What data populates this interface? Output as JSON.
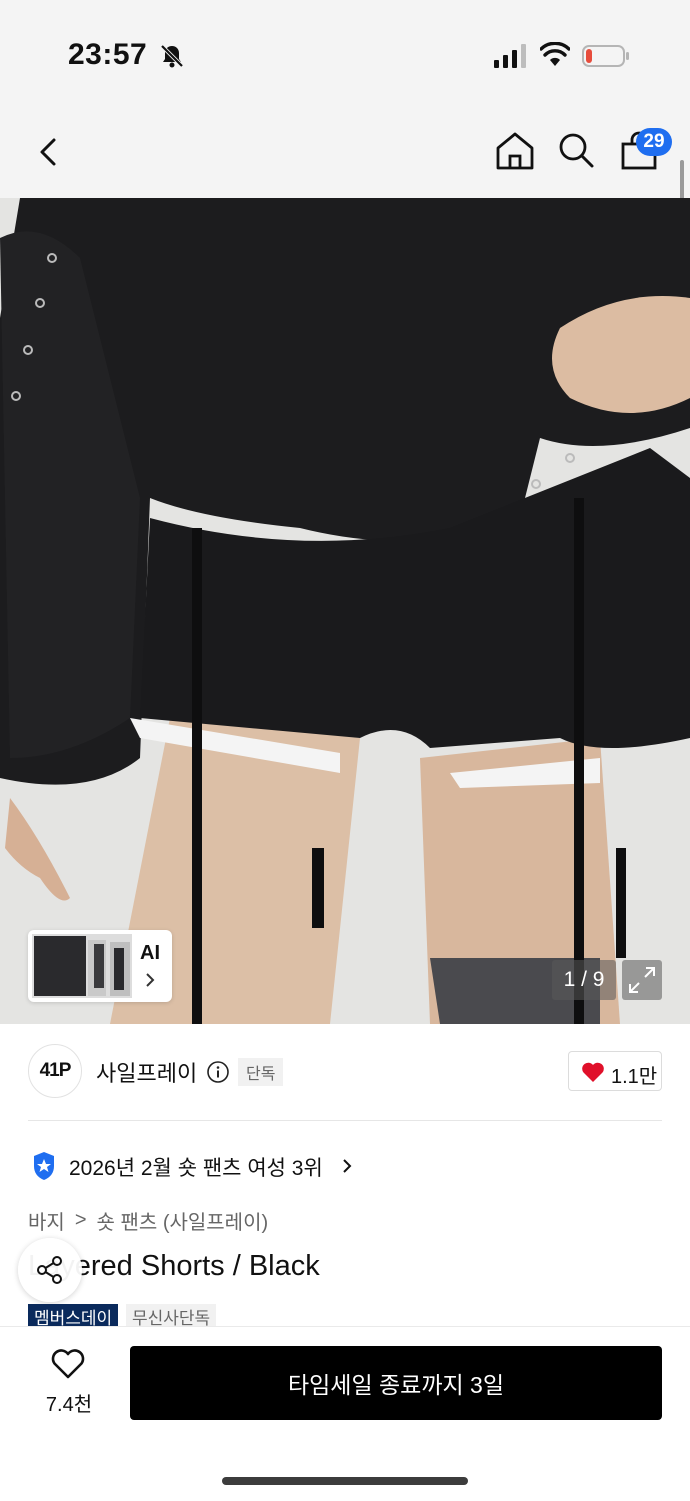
{
  "status_bar": {
    "time": "23:57",
    "icons": [
      "bell-off-icon",
      "signal-icon",
      "wifi-icon",
      "battery-icon"
    ],
    "battery_level_color": "#e74c3c"
  },
  "nav": {
    "icons": [
      "back-icon",
      "home-icon",
      "search-icon",
      "bag-icon"
    ],
    "cart_count": "29",
    "badge_color": "#1f6ef0"
  },
  "gallery": {
    "ai_label": "AI",
    "page_counter": "1 / 9"
  },
  "brand": {
    "logo_text": "41P",
    "name": "사일프레이",
    "exclusive_tag": "단독",
    "like_count": "1.1만",
    "heart_color": "#e0102a"
  },
  "ranking": {
    "text": "2026년 2월 숏 팬츠 여성 3위"
  },
  "breadcrumb": {
    "items": [
      "바지",
      "숏 팬츠 (사일프레이)"
    ],
    "separator": ">"
  },
  "product": {
    "title": "Layered Shorts / Black",
    "tags": [
      "멤버스데이",
      "무신사단독"
    ]
  },
  "bottom_bar": {
    "wish_count": "7.4천",
    "buy_label": "타임세일 종료까지 3일"
  }
}
